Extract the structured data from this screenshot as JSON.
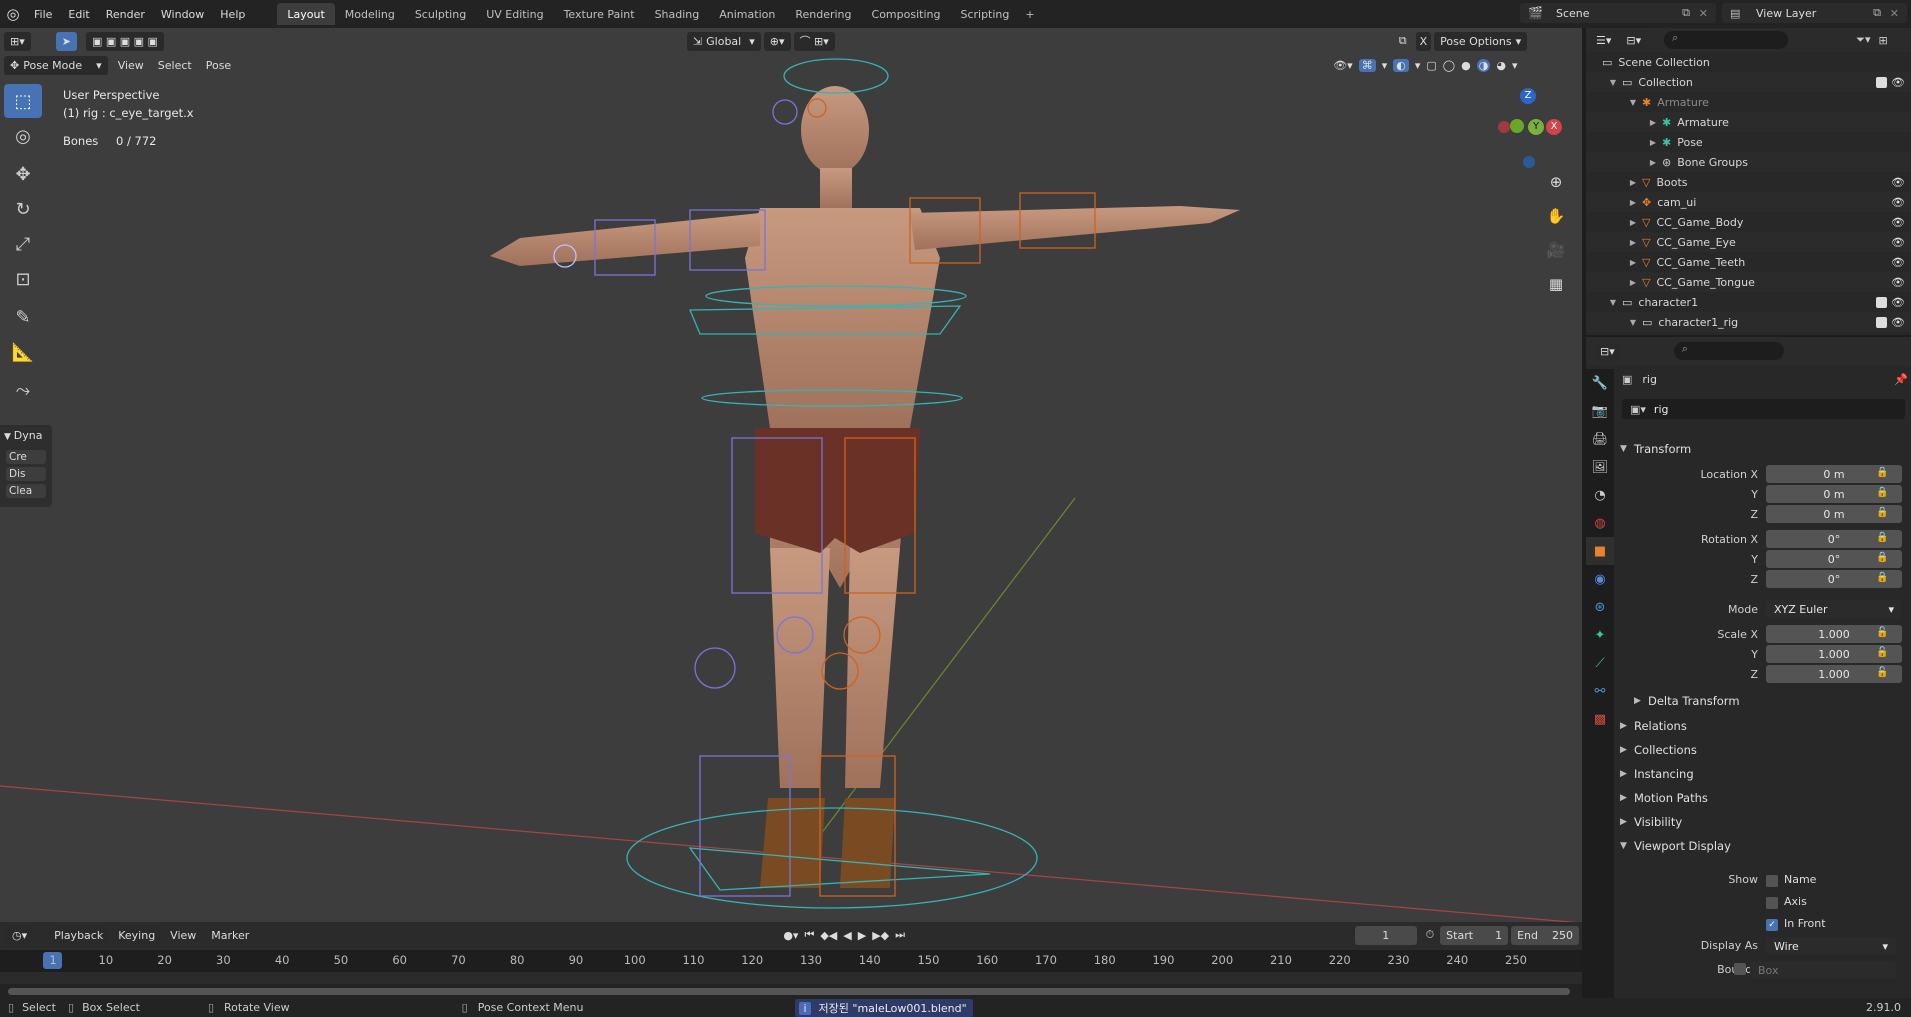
{
  "top": {
    "logo": "blender-logo-icon",
    "menus": [
      "File",
      "Edit",
      "Render",
      "Window",
      "Help"
    ],
    "workspaces": [
      "Layout",
      "Modeling",
      "Sculpting",
      "UV Editing",
      "Texture Paint",
      "Shading",
      "Animation",
      "Rendering",
      "Compositing",
      "Scripting"
    ],
    "active_workspace": "Layout",
    "add_tab": "+",
    "scene": "Scene",
    "view_layer": "View Layer"
  },
  "viewport": {
    "mode": "Pose Mode",
    "menus": [
      "View",
      "Select",
      "Pose"
    ],
    "transform_orientation": "Global",
    "pose_options": "Pose Options",
    "x_label": "X",
    "perspective": "User Perspective",
    "active": "(1) rig : c_eye_target.x",
    "bones_label": "Bones",
    "bones_value": "0 / 772",
    "dyna_tab": "Dyna",
    "dyna_buttons": [
      "Cre",
      "Dis",
      "Clea"
    ],
    "gizmo_axes": {
      "z": "Z",
      "y": "Y",
      "x": "X"
    }
  },
  "timeline": {
    "menus": [
      "Playback",
      "Keying",
      "View",
      "Marker"
    ],
    "current_frame": "1",
    "start_label": "Start",
    "start": "1",
    "end_label": "End",
    "end": "250",
    "ticks": [
      "1",
      "10",
      "20",
      "30",
      "40",
      "50",
      "60",
      "70",
      "80",
      "90",
      "100",
      "110",
      "120",
      "130",
      "140",
      "150",
      "160",
      "170",
      "180",
      "190",
      "200",
      "210",
      "220",
      "230",
      "240",
      "250"
    ]
  },
  "status": {
    "select": "Select",
    "box_select": "Box Select",
    "rotate_view": "Rotate View",
    "context_menu": "Pose Context Menu",
    "message": "저장된 \"maleLow001.blend\"",
    "version": "2.91.0"
  },
  "outliner": {
    "rows": [
      {
        "label": "Scene Collection",
        "indent": 0,
        "icon": "collection-icon",
        "vis": false,
        "check": false,
        "muted": false,
        "alt": false
      },
      {
        "label": "Collection",
        "indent": 1,
        "icon": "collection-icon",
        "vis": true,
        "check": true,
        "muted": false,
        "alt": true
      },
      {
        "label": "Armature",
        "indent": 2,
        "icon": "armature-icon",
        "vis": false,
        "check": false,
        "muted": true,
        "alt": false
      },
      {
        "label": "Armature",
        "indent": 3,
        "icon": "armature-data-icon",
        "vis": false,
        "check": false,
        "muted": false,
        "alt": true
      },
      {
        "label": "Pose",
        "indent": 3,
        "icon": "pose-icon",
        "vis": false,
        "check": false,
        "muted": false,
        "alt": false
      },
      {
        "label": "Bone Groups",
        "indent": 3,
        "icon": "bone-groups-icon",
        "vis": false,
        "check": false,
        "muted": false,
        "alt": true
      },
      {
        "label": "Boots",
        "indent": 2,
        "icon": "mesh-icon",
        "vis": true,
        "check": false,
        "muted": false,
        "alt": false
      },
      {
        "label": "cam_ui",
        "indent": 2,
        "icon": "empty-icon",
        "vis": true,
        "check": false,
        "muted": false,
        "alt": true
      },
      {
        "label": "CC_Game_Body",
        "indent": 2,
        "icon": "mesh-icon",
        "vis": true,
        "check": false,
        "muted": false,
        "alt": false
      },
      {
        "label": "CC_Game_Eye",
        "indent": 2,
        "icon": "mesh-icon",
        "vis": true,
        "check": false,
        "muted": false,
        "alt": true
      },
      {
        "label": "CC_Game_Teeth",
        "indent": 2,
        "icon": "mesh-icon",
        "vis": true,
        "check": false,
        "muted": false,
        "alt": false
      },
      {
        "label": "CC_Game_Tongue",
        "indent": 2,
        "icon": "mesh-icon",
        "vis": true,
        "check": false,
        "muted": false,
        "alt": true
      },
      {
        "label": "character1",
        "indent": 1,
        "icon": "collection-icon",
        "vis": true,
        "check": true,
        "muted": false,
        "alt": false
      },
      {
        "label": "character1_rig",
        "indent": 2,
        "icon": "collection-icon",
        "vis": true,
        "check": true,
        "muted": false,
        "alt": true
      }
    ]
  },
  "properties": {
    "object_name": "rig",
    "data_name": "rig",
    "transform": "Transform",
    "location_label": "Location X",
    "location": [
      "0 m",
      "0 m",
      "0 m"
    ],
    "rotation_label": "Rotation X",
    "rotation": [
      "0°",
      "0°",
      "0°"
    ],
    "y_label": "Y",
    "z_label": "Z",
    "mode_label": "Mode",
    "mode_value": "XYZ Euler",
    "scale_label": "Scale X",
    "scale": [
      "1.000",
      "1.000",
      "1.000"
    ],
    "delta_transform": "Delta Transform",
    "sections": [
      "Relations",
      "Collections",
      "Instancing",
      "Motion Paths",
      "Visibility"
    ],
    "viewport_display": "Viewport Display",
    "show_label": "Show",
    "show_name": "Name",
    "show_axis": "Axis",
    "in_front": "In Front",
    "display_as_label": "Display As",
    "display_as": "Wire",
    "bounds_label": "Bounds",
    "bounds_value": "Box"
  }
}
